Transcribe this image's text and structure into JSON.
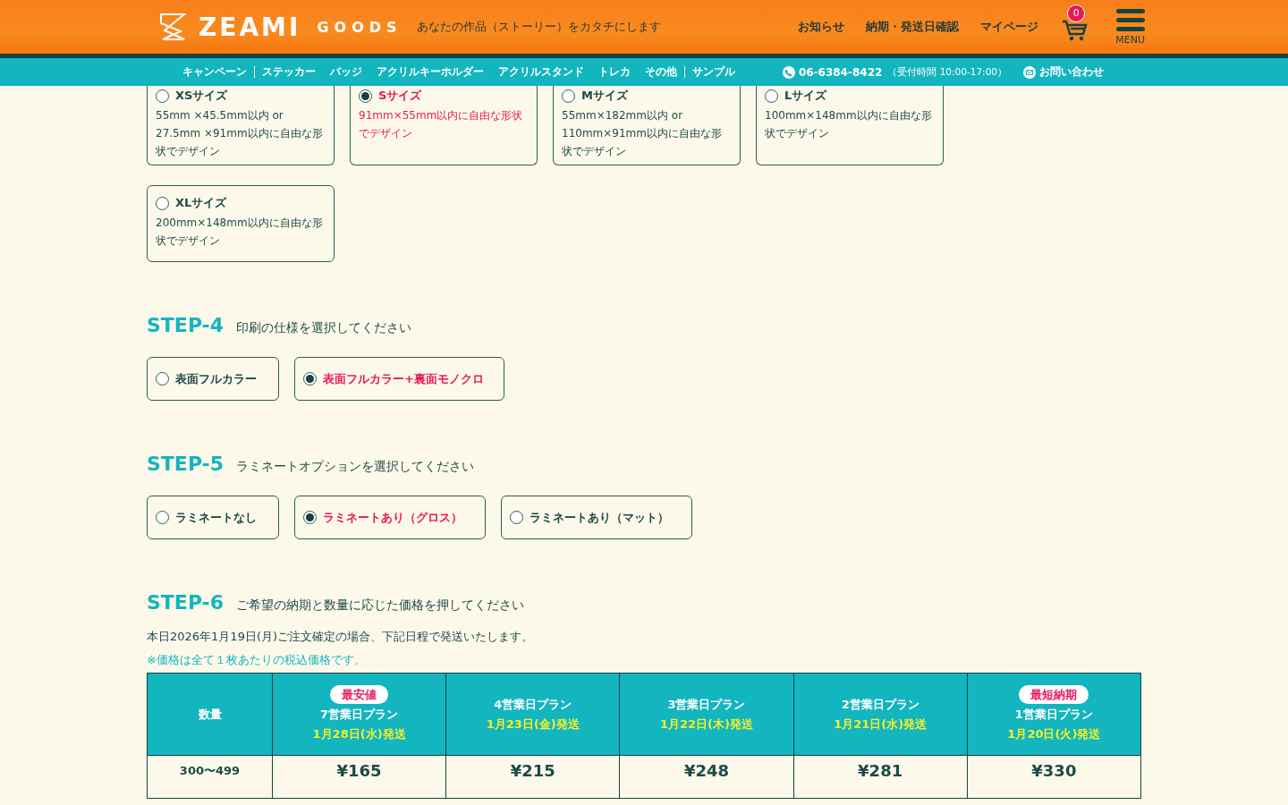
{
  "header": {
    "logo": "ZEAMI",
    "logo_sub": "GOODS",
    "tagline": "あなたの作品（ストーリー）をカタチにします",
    "links": [
      "お知らせ",
      "納期・発送日確認",
      "マイページ"
    ],
    "cart_count": "0",
    "menu_label": "MENU"
  },
  "nav": {
    "items": [
      {
        "label": "キャンペーン",
        "divider_after": true
      },
      {
        "label": "ステッカー",
        "divider_after": false
      },
      {
        "label": "バッジ",
        "divider_after": false
      },
      {
        "label": "アクリルキーホルダー",
        "divider_after": false
      },
      {
        "label": "アクリルスタンド",
        "divider_after": false
      },
      {
        "label": "トレカ",
        "divider_after": false
      },
      {
        "label": "その他",
        "divider_after": true
      },
      {
        "label": "サンプル",
        "divider_after": false
      }
    ],
    "phone": "06-6384-8422",
    "hours": "（受付時間 10:00-17:00）",
    "contact": "お問い合わせ"
  },
  "sizes": [
    {
      "label": "XSサイズ",
      "description": "55mm ×45.5mm以内 or 27.5mm ×91mm以内に自由な形状でデザイン",
      "selected": false
    },
    {
      "label": "Sサイズ",
      "description": "91mm×55mm以内に自由な形状でデザイン",
      "selected": true
    },
    {
      "label": "Mサイズ",
      "description": "55mm×182mm以内 or 110mm×91mm以内に自由な形状でデザイン",
      "selected": false
    },
    {
      "label": "Lサイズ",
      "description": "100mm×148mm以内に自由な形状でデザイン",
      "selected": false
    },
    {
      "label": "XLサイズ",
      "description": "200mm×148mm以内に自由な形状でデザイン",
      "selected": false
    }
  ],
  "steps": [
    {
      "number": "STEP-4",
      "instruction": "印刷の仕様を選択してください",
      "options": [
        {
          "label": "表面フルカラー",
          "selected": false
        },
        {
          "label": "表面フルカラー+裏面モノクロ",
          "selected": true
        }
      ]
    },
    {
      "number": "STEP-5",
      "instruction": "ラミネートオプションを選択してください",
      "options": [
        {
          "label": "ラミネートなし",
          "selected": false
        },
        {
          "label": "ラミネートあり（グロス）",
          "selected": true
        },
        {
          "label": "ラミネートあり（マット）",
          "selected": false
        }
      ]
    }
  ],
  "step6": {
    "number": "STEP-6",
    "instruction": "ご希望の納期と数量に応じた価格を押してください",
    "notice": "本日2026年1月19日(月)ご注文確定の場合、下記日程で発送いたします。",
    "note": "※価格は全て１枚あたりの税込価格です。",
    "table": {
      "quantity_header": "数量",
      "columns": [
        {
          "badge": "最安値",
          "plan": "7営業日プラン",
          "date": "1月28日(水)発送"
        },
        {
          "plan": "4営業日プラン",
          "date": "1月23日(金)発送"
        },
        {
          "plan": "3営業日プラン",
          "date": "1月22日(木)発送"
        },
        {
          "plan": "2営業日プラン",
          "date": "1月21日(水)発送"
        },
        {
          "badge": "最短納期",
          "plan": "1営業日プラン",
          "date": "1月20日(火)発送"
        }
      ],
      "rows": [
        {
          "quantity": "300〜499",
          "prices": [
            "¥165",
            "¥215",
            "¥248",
            "¥281",
            "¥330"
          ]
        }
      ]
    }
  }
}
